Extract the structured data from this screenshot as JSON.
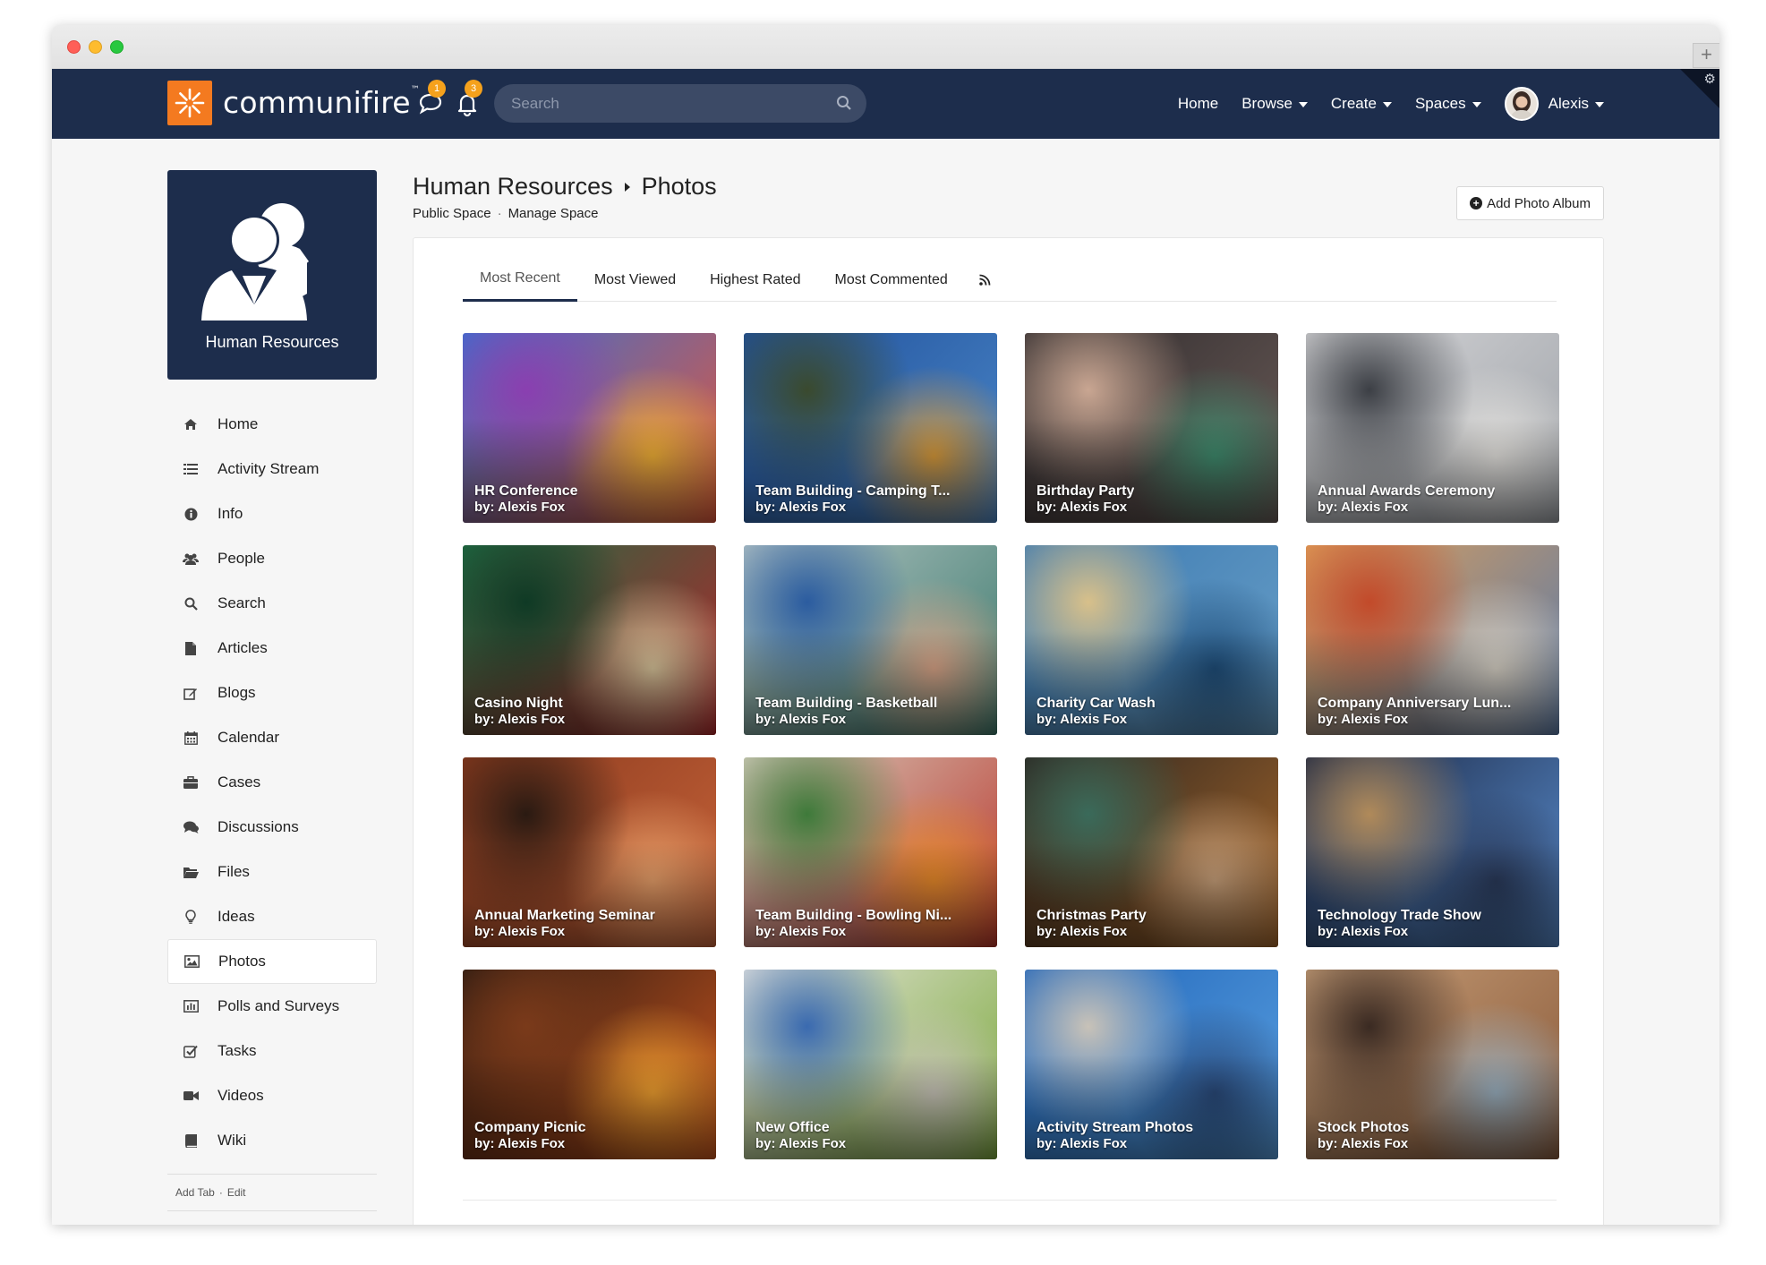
{
  "brand": {
    "name": "communifire",
    "tm": "™"
  },
  "navbar": {
    "messages_badge": "1",
    "notifications_badge": "3",
    "search_placeholder": "Search",
    "links": [
      {
        "label": "Home",
        "has_caret": false
      },
      {
        "label": "Browse",
        "has_caret": true
      },
      {
        "label": "Create",
        "has_caret": true
      },
      {
        "label": "Spaces",
        "has_caret": true
      }
    ],
    "user": {
      "name": "Alexis"
    }
  },
  "space": {
    "title": "Human Resources",
    "name": "Human Resources",
    "section": "Photos",
    "visibility": "Public Space",
    "manage_label": "Manage Space",
    "sub_separator": "·"
  },
  "add_album_label": "Add Photo Album",
  "sidebar": {
    "items": [
      {
        "label": "Home",
        "icon": "home-icon",
        "active": false
      },
      {
        "label": "Activity Stream",
        "icon": "list-icon",
        "active": false
      },
      {
        "label": "Info",
        "icon": "info-icon",
        "active": false
      },
      {
        "label": "People",
        "icon": "people-icon",
        "active": false
      },
      {
        "label": "Search",
        "icon": "search-icon",
        "active": false
      },
      {
        "label": "Articles",
        "icon": "article-icon",
        "active": false
      },
      {
        "label": "Blogs",
        "icon": "blog-icon",
        "active": false
      },
      {
        "label": "Calendar",
        "icon": "calendar-icon",
        "active": false
      },
      {
        "label": "Cases",
        "icon": "briefcase-icon",
        "active": false
      },
      {
        "label": "Discussions",
        "icon": "comments-icon",
        "active": false
      },
      {
        "label": "Files",
        "icon": "folder-icon",
        "active": false
      },
      {
        "label": "Ideas",
        "icon": "lightbulb-icon",
        "active": false
      },
      {
        "label": "Photos",
        "icon": "photo-icon",
        "active": true
      },
      {
        "label": "Polls and Surveys",
        "icon": "bar-chart-icon",
        "active": false
      },
      {
        "label": "Tasks",
        "icon": "checkbox-icon",
        "active": false
      },
      {
        "label": "Videos",
        "icon": "video-camera-icon",
        "active": false
      },
      {
        "label": "Wiki",
        "icon": "book-icon",
        "active": false
      }
    ],
    "footer": {
      "add_tab": "Add Tab",
      "separator": "·",
      "edit": "Edit"
    }
  },
  "tabs": [
    {
      "label": "Most Recent",
      "active": true
    },
    {
      "label": "Most Viewed",
      "active": false
    },
    {
      "label": "Highest Rated",
      "active": false
    },
    {
      "label": "Most Commented",
      "active": false
    }
  ],
  "albums": [
    {
      "title": "HR Conference",
      "author": "by: Alexis Fox",
      "colors": [
        "#3a6fd0",
        "#e2563b",
        "#8a3fb0",
        "#f2b136"
      ]
    },
    {
      "title": "Team Building - Camping T...",
      "author": "by: Alexis Fox",
      "colors": [
        "#1f4f9a",
        "#4b87c8",
        "#3a4a2e",
        "#d89a3a"
      ]
    },
    {
      "title": "Birthday Party",
      "author": "by: Alexis Fox",
      "colors": [
        "#2e2a2c",
        "#6b5c58",
        "#c9a692",
        "#3f8c6e"
      ]
    },
    {
      "title": "Annual Awards Ceremony",
      "author": "by: Alexis Fox",
      "colors": [
        "#d8d8da",
        "#9ea2a8",
        "#3c3f45",
        "#e6e4e0"
      ]
    },
    {
      "title": "Casino Night",
      "author": "by: Alexis Fox",
      "colors": [
        "#1f6b43",
        "#b2272b",
        "#0f3a25",
        "#d8c49a"
      ]
    },
    {
      "title": "Team Building - Basketball",
      "author": "by: Alexis Fox",
      "colors": [
        "#b7c6c6",
        "#3c7a6c",
        "#2b5ca0",
        "#d9a487"
      ]
    },
    {
      "title": "Charity Car Wash",
      "author": "by: Alexis Fox",
      "colors": [
        "#3a78b0",
        "#6aa0c8",
        "#d8c08a",
        "#1f4e7a"
      ]
    },
    {
      "title": "Company Anniversary Lun...",
      "author": "by: Alexis Fox",
      "colors": [
        "#e0a05a",
        "#5a7aa8",
        "#c24a2a",
        "#d8d2c6"
      ]
    },
    {
      "title": "Annual Marketing Seminar",
      "author": "by: Alexis Fox",
      "colors": [
        "#8a3a1e",
        "#c8643a",
        "#2a1a12",
        "#e8a06a"
      ]
    },
    {
      "title": "Team Building - Bowling Ni...",
      "author": "by: Alexis Fox",
      "colors": [
        "#d8cfc0",
        "#b8342a",
        "#3e7a3a",
        "#e88a2a"
      ]
    },
    {
      "title": "Christmas Party",
      "author": "by: Alexis Fox",
      "colors": [
        "#2a2420",
        "#a5662a",
        "#3a6a5a",
        "#c8a07a"
      ]
    },
    {
      "title": "Technology Trade Show",
      "author": "by: Alexis Fox",
      "colors": [
        "#1a2540",
        "#5a8ed0",
        "#b08a5a",
        "#2a3a5a"
      ]
    },
    {
      "title": "Company Picnic",
      "author": "by: Alexis Fox",
      "colors": [
        "#2a1a12",
        "#c8541e",
        "#7a3a1a",
        "#f0a030"
      ]
    },
    {
      "title": "New Office",
      "author": "by: Alexis Fox",
      "colors": [
        "#e8e6e0",
        "#7aa83a",
        "#3a6ab0",
        "#c8c4b8"
      ]
    },
    {
      "title": "Activity Stream Photos",
      "author": "by: Alexis Fox",
      "colors": [
        "#1e63b8",
        "#5aa0e0",
        "#c8c2b8",
        "#2a4a7a"
      ]
    },
    {
      "title": "Stock Photos",
      "author": "by: Alexis Fox",
      "colors": [
        "#c8a07a",
        "#8a5a3a",
        "#3a2a22",
        "#9ab0c0"
      ]
    }
  ],
  "colors": {
    "navbar": "#1d2d4c",
    "brand_orange": "#f47a20",
    "badge": "#f5a11c"
  }
}
